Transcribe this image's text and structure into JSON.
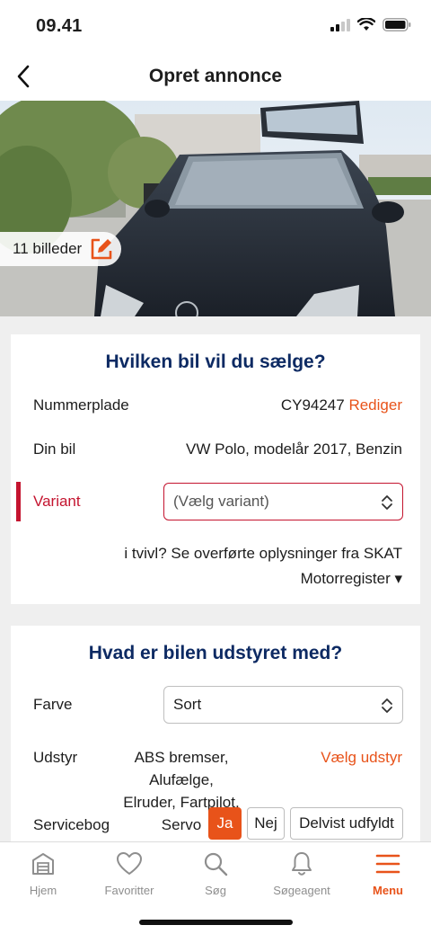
{
  "status_bar": {
    "time": "09.41"
  },
  "nav": {
    "title": "Opret annonce"
  },
  "photo": {
    "image_count_label": "11 billeder"
  },
  "card_car": {
    "title": "Hvilken bil vil du sælge?",
    "plate_label": "Nummerplade",
    "plate_value": "CY94247",
    "plate_edit": "Rediger",
    "car_label": "Din bil",
    "car_value": "VW Polo, modelår 2017, Benzin",
    "variant_label": "Variant",
    "variant_placeholder": "(Vælg variant)",
    "skat_line1": "i tvivl? Se overførte oplysninger fra SKAT",
    "skat_line2": "Motorregister ▾"
  },
  "card_equipment": {
    "title": "Hvad er bilen udstyret med?",
    "color_label": "Farve",
    "color_value": "Sort",
    "equipment_label": "Udstyr",
    "equipment_line1": "ABS bremser, Alufælge,",
    "equipment_line2": "Elruder, Fartpilot, Servo",
    "equipment_choose": "Vælg udstyr",
    "servicebook_label": "Servicebog",
    "servicebook_options": [
      "Ja",
      "Nej",
      "Delvist udfyldt"
    ],
    "servicebook_selected": "Ja"
  },
  "tabbar": {
    "items": [
      {
        "label": "Hjem",
        "icon": "garage-icon"
      },
      {
        "label": "Favoritter",
        "icon": "heart-icon"
      },
      {
        "label": "Søg",
        "icon": "search-icon"
      },
      {
        "label": "Søgeagent",
        "icon": "bell-icon"
      },
      {
        "label": "Menu",
        "icon": "hamburger-icon",
        "active": true
      }
    ]
  },
  "colors": {
    "accent": "#e8531a",
    "title_blue": "#0d2a63",
    "error_red": "#c4142f"
  }
}
